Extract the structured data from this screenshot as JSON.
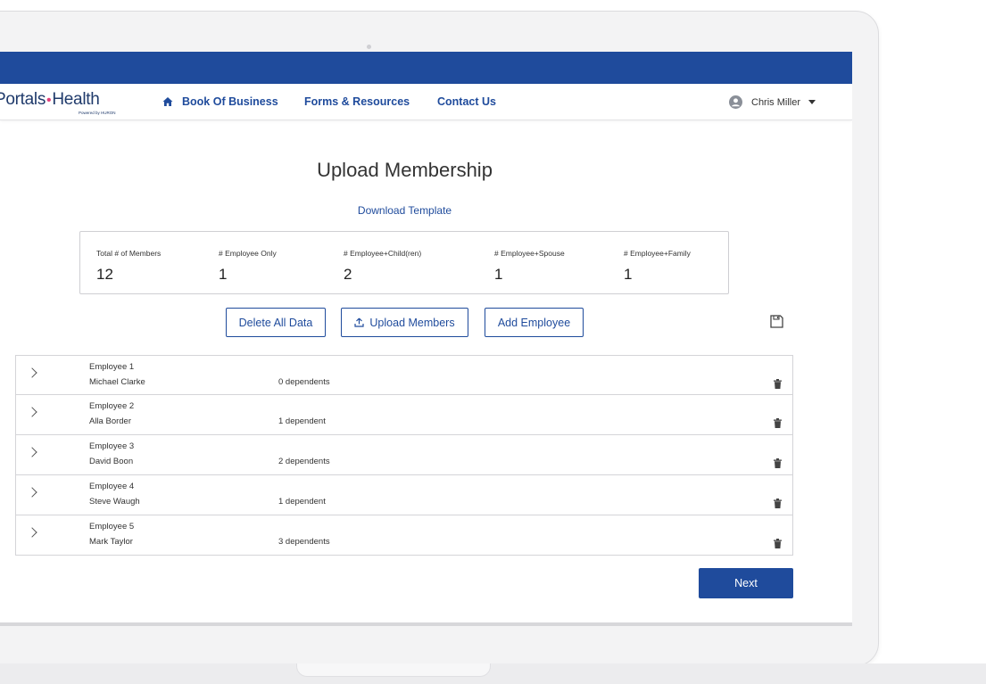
{
  "brand": {
    "logo_left": "Portals",
    "logo_dot": "•",
    "logo_right": "Health",
    "logo_sub": "Powered by HURON"
  },
  "nav": {
    "home_icon": "home-icon",
    "links": [
      "Book Of Business",
      "Forms & Resources",
      "Contact Us"
    ],
    "user_name": "Chris Miller"
  },
  "page": {
    "title": "Upload Membership",
    "download_link": "Download Template"
  },
  "stats": [
    {
      "label": "Total # of Members",
      "value": "12"
    },
    {
      "label": "# Employee Only",
      "value": "1"
    },
    {
      "label": "# Employee+Child(ren)",
      "value": "2"
    },
    {
      "label": "# Employee+Spouse",
      "value": "1"
    },
    {
      "label": "# Employee+Family",
      "value": "1"
    }
  ],
  "actions": {
    "delete_all": "Delete All Data",
    "upload_members": "Upload Members",
    "add_employee": "Add Employee",
    "upload_icon": "upload-icon",
    "save_icon": "save-icon"
  },
  "employees": [
    {
      "title": "Employee 1",
      "name": "Michael Clarke",
      "dependents": "0 dependents"
    },
    {
      "title": "Employee 2",
      "name": "Alla Border",
      "dependents": "1 dependent"
    },
    {
      "title": "Employee 3",
      "name": "David Boon",
      "dependents": "2 dependents"
    },
    {
      "title": "Employee 4",
      "name": "Steve Waugh",
      "dependents": "1 dependent"
    },
    {
      "title": "Employee 5",
      "name": "Mark Taylor",
      "dependents": "3 dependents"
    }
  ],
  "footer": {
    "next_label": "Next"
  },
  "colors": {
    "brand_blue": "#1f4b9c",
    "logo_dot": "#e23f7a"
  }
}
